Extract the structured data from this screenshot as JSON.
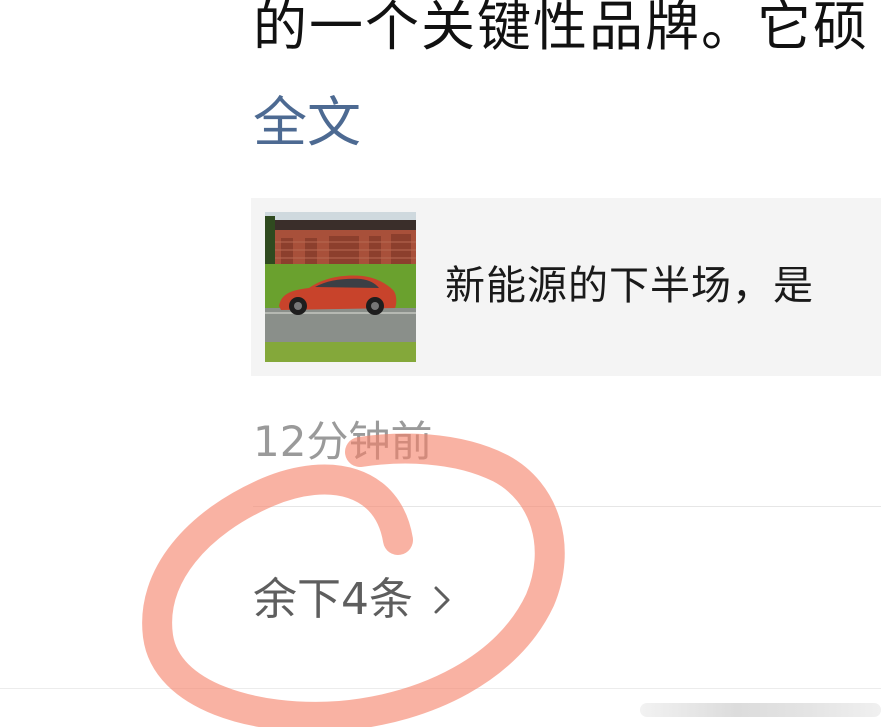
{
  "post": {
    "body_text": "的一个关键性品牌。它硕",
    "full_text_link": "全文"
  },
  "link_card": {
    "title": "新能源的下半场，是",
    "thumbnail_icon": "car-photo-thumbnail"
  },
  "timestamp": "12分钟前",
  "comments": {
    "remaining_label": "余下4条",
    "chevron_icon": "chevron-right-icon"
  },
  "colors": {
    "link": "#4d6a92",
    "annotation": "#f5836a",
    "card_bg": "#f4f4f4",
    "muted_text": "#9a9a9a"
  }
}
